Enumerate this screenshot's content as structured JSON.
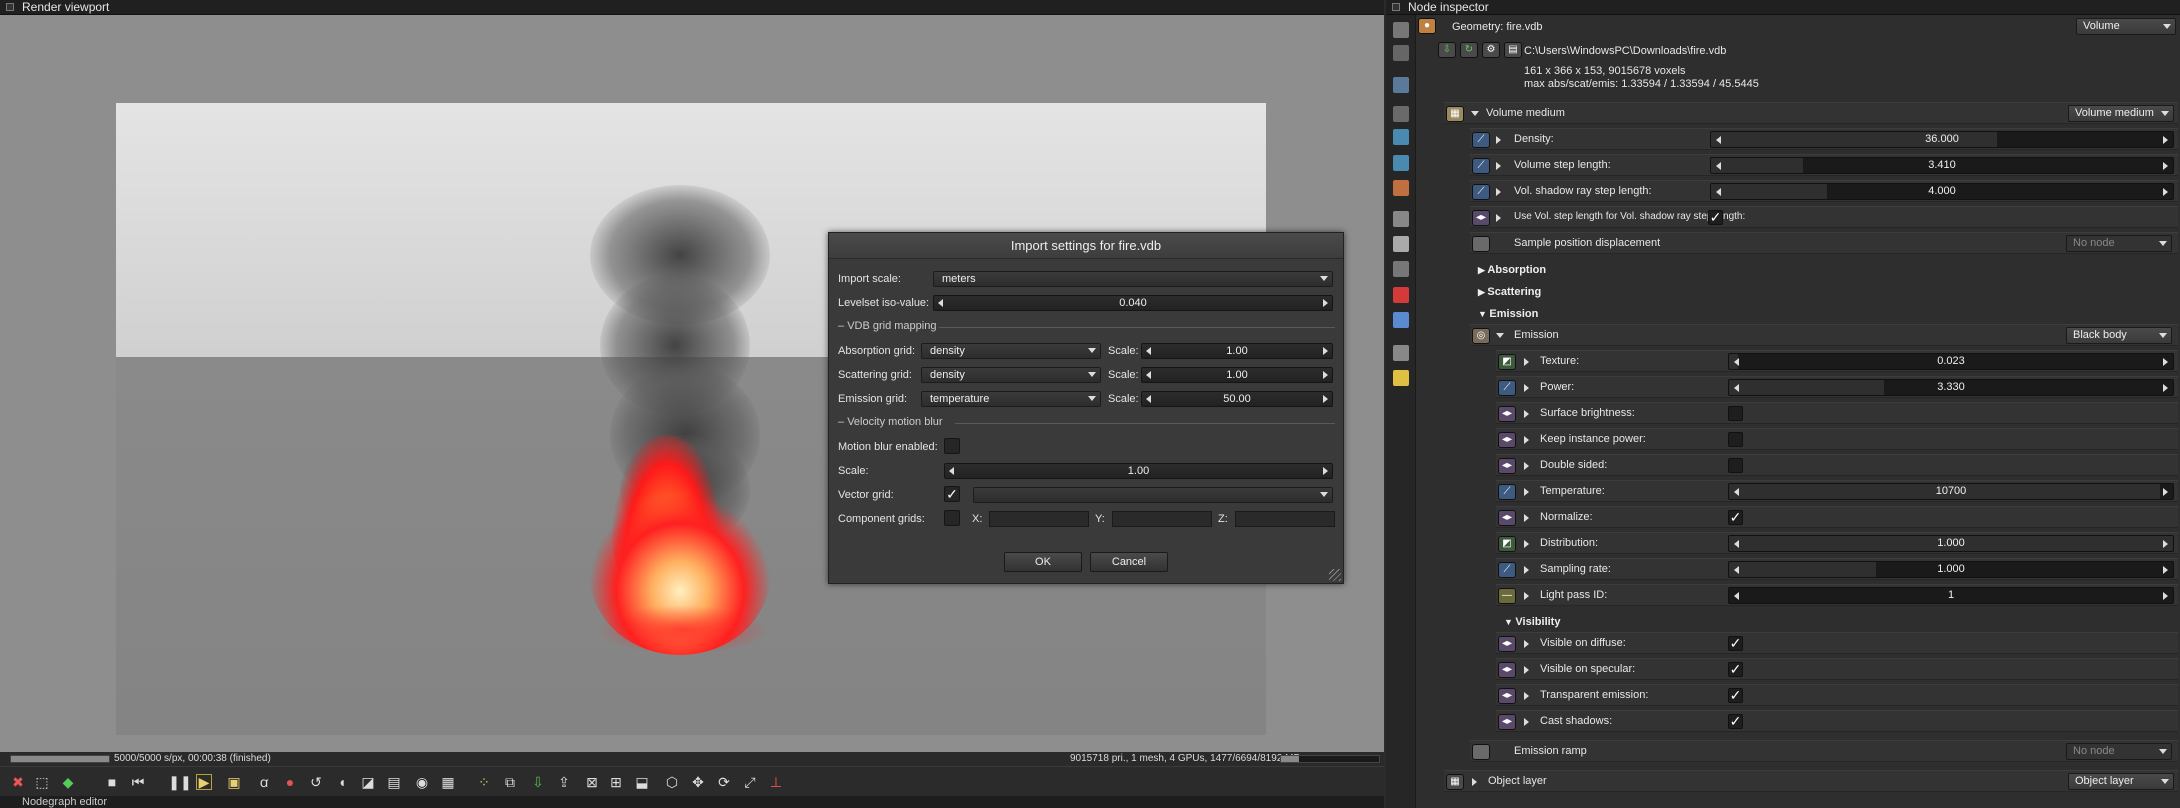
{
  "viewport": {
    "title": "Render viewport",
    "status_left": "5000/5000 s/px, 00:00:38 (finished)",
    "status_right": "9015718 pri., 1 mesh, 4 GPUs, 1477/6694/8192 MB",
    "progress": 1.0,
    "bottom_panel_title": "Nodegraph editor"
  },
  "dialog": {
    "title": "Import settings for fire.vdb",
    "import_scale_label": "Import scale:",
    "import_scale_value": "meters",
    "levelset_label": "Levelset iso-value:",
    "levelset_value": "0.040",
    "vdb_section": "VDB grid mapping",
    "absorption_label": "Absorption grid:",
    "absorption_value": "density",
    "absorption_scale": "1.00",
    "scattering_label": "Scattering grid:",
    "scattering_value": "density",
    "scattering_scale": "1.00",
    "emission_label": "Emission grid:",
    "emission_value": "temperature",
    "emission_scale": "50.00",
    "scale_label": "Scale:",
    "velocity_section": "Velocity motion blur",
    "motion_blur_label": "Motion blur enabled:",
    "motion_scale_label": "Scale:",
    "motion_scale_value": "1.00",
    "vector_grid_label": "Vector grid:",
    "component_label": "Component grids:",
    "x_label": "X:",
    "y_label": "Y:",
    "z_label": "Z:",
    "ok": "OK",
    "cancel": "Cancel"
  },
  "inspector": {
    "title": "Node inspector",
    "geometry_label": "Geometry: fire.vdb",
    "geometry_type": "Volume",
    "path": "C:\\Users\\WindowsPC\\Downloads\\fire.vdb",
    "voxels": "161 x 366 x 153, 9015678 voxels",
    "max": "max abs/scat/emis: 1.33594 / 1.33594 / 45.5445",
    "volume_medium": "Volume medium",
    "volume_medium_type": "Volume medium",
    "density_label": "Density:",
    "density_value": "36.000",
    "step_label": "Volume step length:",
    "step_value": "3.410",
    "shadow_step_label": "Vol. shadow ray step length:",
    "shadow_step_value": "4.000",
    "use_vol_step_label": "Use Vol. step length for Vol. shadow ray step length:",
    "sample_disp_label": "Sample position displacement",
    "no_node": "No node",
    "absorption": "Absorption",
    "scattering": "Scattering",
    "emission_section": "Emission",
    "emission_label": "Emission",
    "emission_type": "Black body",
    "texture_label": "Texture:",
    "texture_value": "0.023",
    "power_label": "Power:",
    "power_value": "3.330",
    "surface_brightness_label": "Surface brightness:",
    "keep_instance_label": "Keep instance power:",
    "double_sided_label": "Double sided:",
    "temperature_label": "Temperature:",
    "temperature_value": "10700",
    "normalize_label": "Normalize:",
    "distribution_label": "Distribution:",
    "distribution_value": "1.000",
    "sampling_label": "Sampling rate:",
    "sampling_value": "1.000",
    "lightpass_label": "Light pass ID:",
    "lightpass_value": "1",
    "visibility": "Visibility",
    "vis_diffuse_label": "Visible on diffuse:",
    "vis_specular_label": "Visible on specular:",
    "transparent_label": "Transparent emission:",
    "cast_shadows_label": "Cast shadows:",
    "emission_ramp_label": "Emission ramp",
    "object_layer_label": "Object layer",
    "object_layer_type": "Object layer"
  }
}
